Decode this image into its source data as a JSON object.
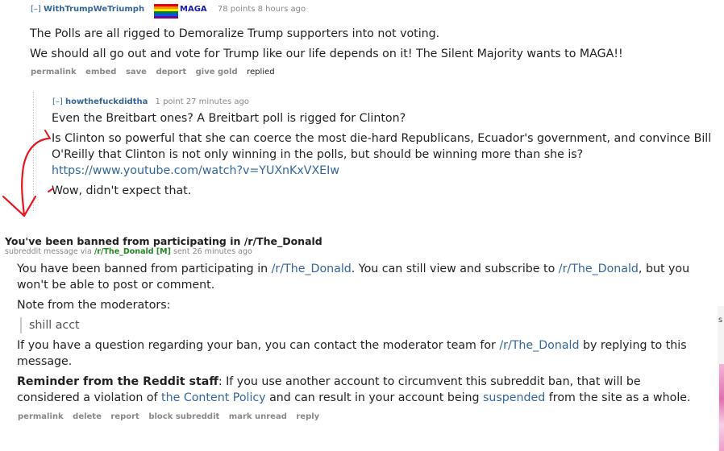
{
  "parent_comment": {
    "toggle": "[–]",
    "author": "WithTrumpWeTriumph",
    "flair": "MAGA",
    "score": "78 points",
    "time": "8 hours ago",
    "lines": [
      "The Polls are all rigged to Demoralize Trump supporters into not voting.",
      "We should all go out and vote for Trump like our life depends on it! The Silent Majority wants to MAGA!!"
    ],
    "buttons": [
      "permalink",
      "embed",
      "save",
      "deport",
      "give gold"
    ],
    "replied": "replied"
  },
  "child_comment": {
    "toggle": "[–]",
    "author": "howthefuckdidtha",
    "score": "1 point",
    "time": "27 minutes ago",
    "line1": "Even the Breitbart ones? A Breitbart poll is rigged for Clinton?",
    "line2a": "Is Clinton so powerful that she can coerce the most die-hard Republicans, Ecuador's government, and convince Bill",
    "line2b": "O'Reilly that Clinton is not only winning in the polls, but should be winning more than she is?",
    "link": "https://www.youtube.com/watch?v=YUXnKxVXEIw",
    "line3": "Wow, didn't expect that."
  },
  "ban_message": {
    "subject": "You've been banned from participating in /r/The_Donald",
    "tagline_prefix": "subreddit message via",
    "tagline_sub": "/r/The_Donald [M]",
    "tagline_time": "sent 26 minutes ago",
    "p1_a": "You have been banned from participating in",
    "p1_link1": "/r/The_Donald",
    "p1_b": ". You can still view and subscribe to",
    "p1_link2": "/r/The_Donald",
    "p1_c": ", but you",
    "p1_line2": "won't be able to post or comment.",
    "note_label": "Note from the moderators:",
    "note_quote": "shill acct",
    "p3_a": "If you have a question regarding your ban, you can contact the moderator team for",
    "p3_link": "/r/The_Donald",
    "p3_b": "by replying to this",
    "p3_line2": "message.",
    "reminder_label": "Reminder from the Reddit staff",
    "reminder_a": ": If you use another account to circumvent this subreddit ban, that will be",
    "reminder_b": "considered a violation of",
    "reminder_link1": "the Content Policy",
    "reminder_c": "and can result in your account being",
    "reminder_link2": "suspended",
    "reminder_d": "from the site as a whole.",
    "buttons": [
      "permalink",
      "delete",
      "report",
      "block subreddit",
      "mark unread",
      "reply"
    ]
  },
  "annotation": {
    "color": "#e8141c"
  },
  "side_strip": {
    "mark": "s"
  }
}
